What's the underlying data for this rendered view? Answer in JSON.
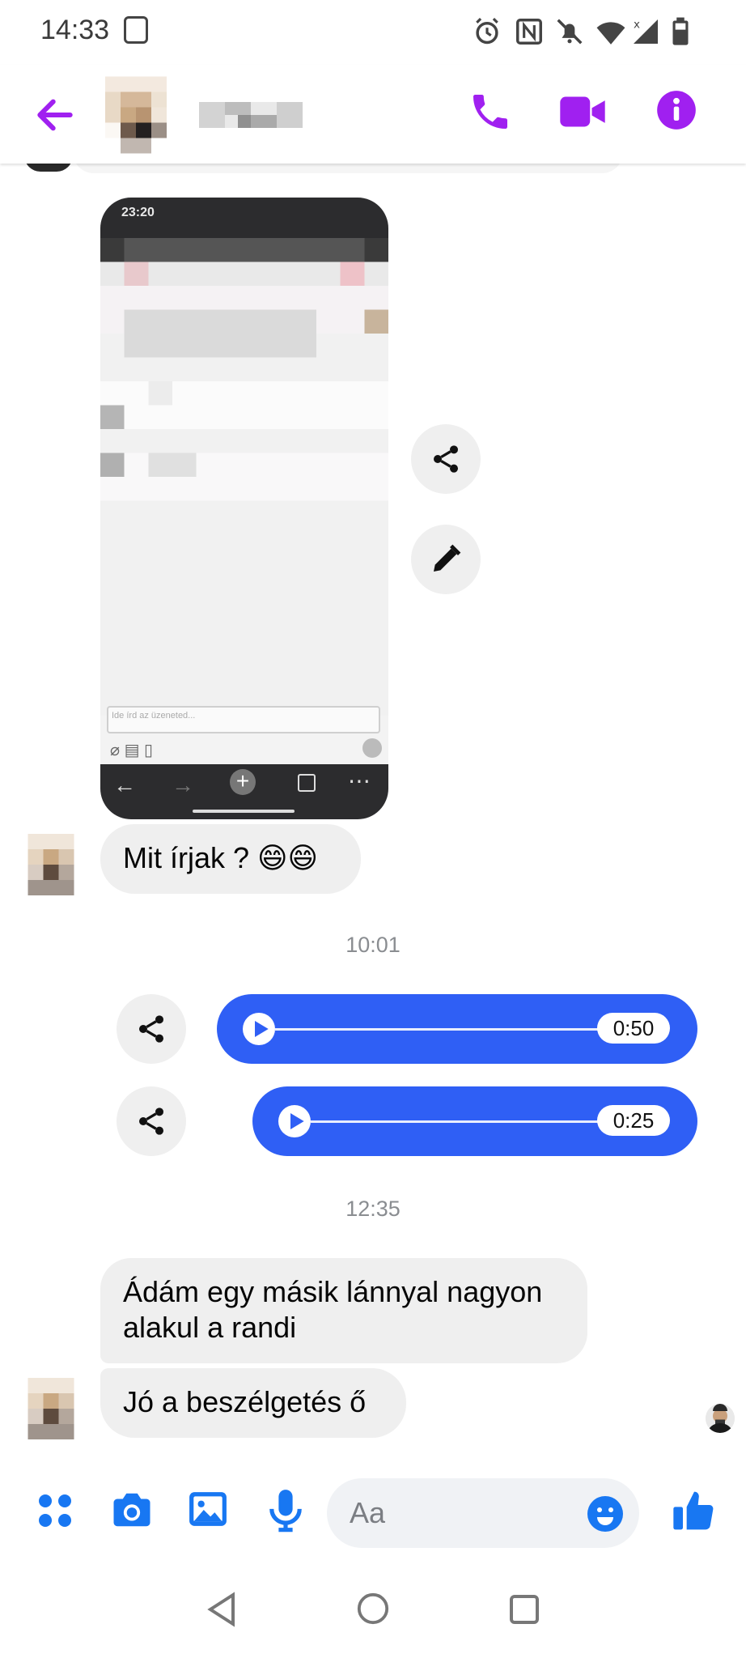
{
  "status_bar": {
    "time": "14:33"
  },
  "header": {
    "contact_name": "",
    "icons": [
      "back-arrow-icon",
      "phone-icon",
      "video-camera-icon",
      "info-icon"
    ],
    "accent_color": "#a020f0"
  },
  "shared_screenshot": {
    "time": "23:20",
    "input_placeholder": "Ide írd az üzeneted..."
  },
  "messages": {
    "m1": "Mit írjak ? 😄😄",
    "ts1": "10:01",
    "audio1_duration": "0:50",
    "audio2_duration": "0:25",
    "ts2": "12:35",
    "m2": "Ádám egy másik lánnyal nagyon alakul a randi",
    "m3": "Jó a beszélgetés ő"
  },
  "composer": {
    "placeholder": "Aa",
    "accent_color": "#1877f2",
    "icons": [
      "apps-icon",
      "camera-icon",
      "gallery-icon",
      "microphone-icon",
      "emoji-icon",
      "thumbs-up-icon"
    ]
  },
  "bubble_color": "#efefef",
  "audio_color": "#2f5ff5"
}
